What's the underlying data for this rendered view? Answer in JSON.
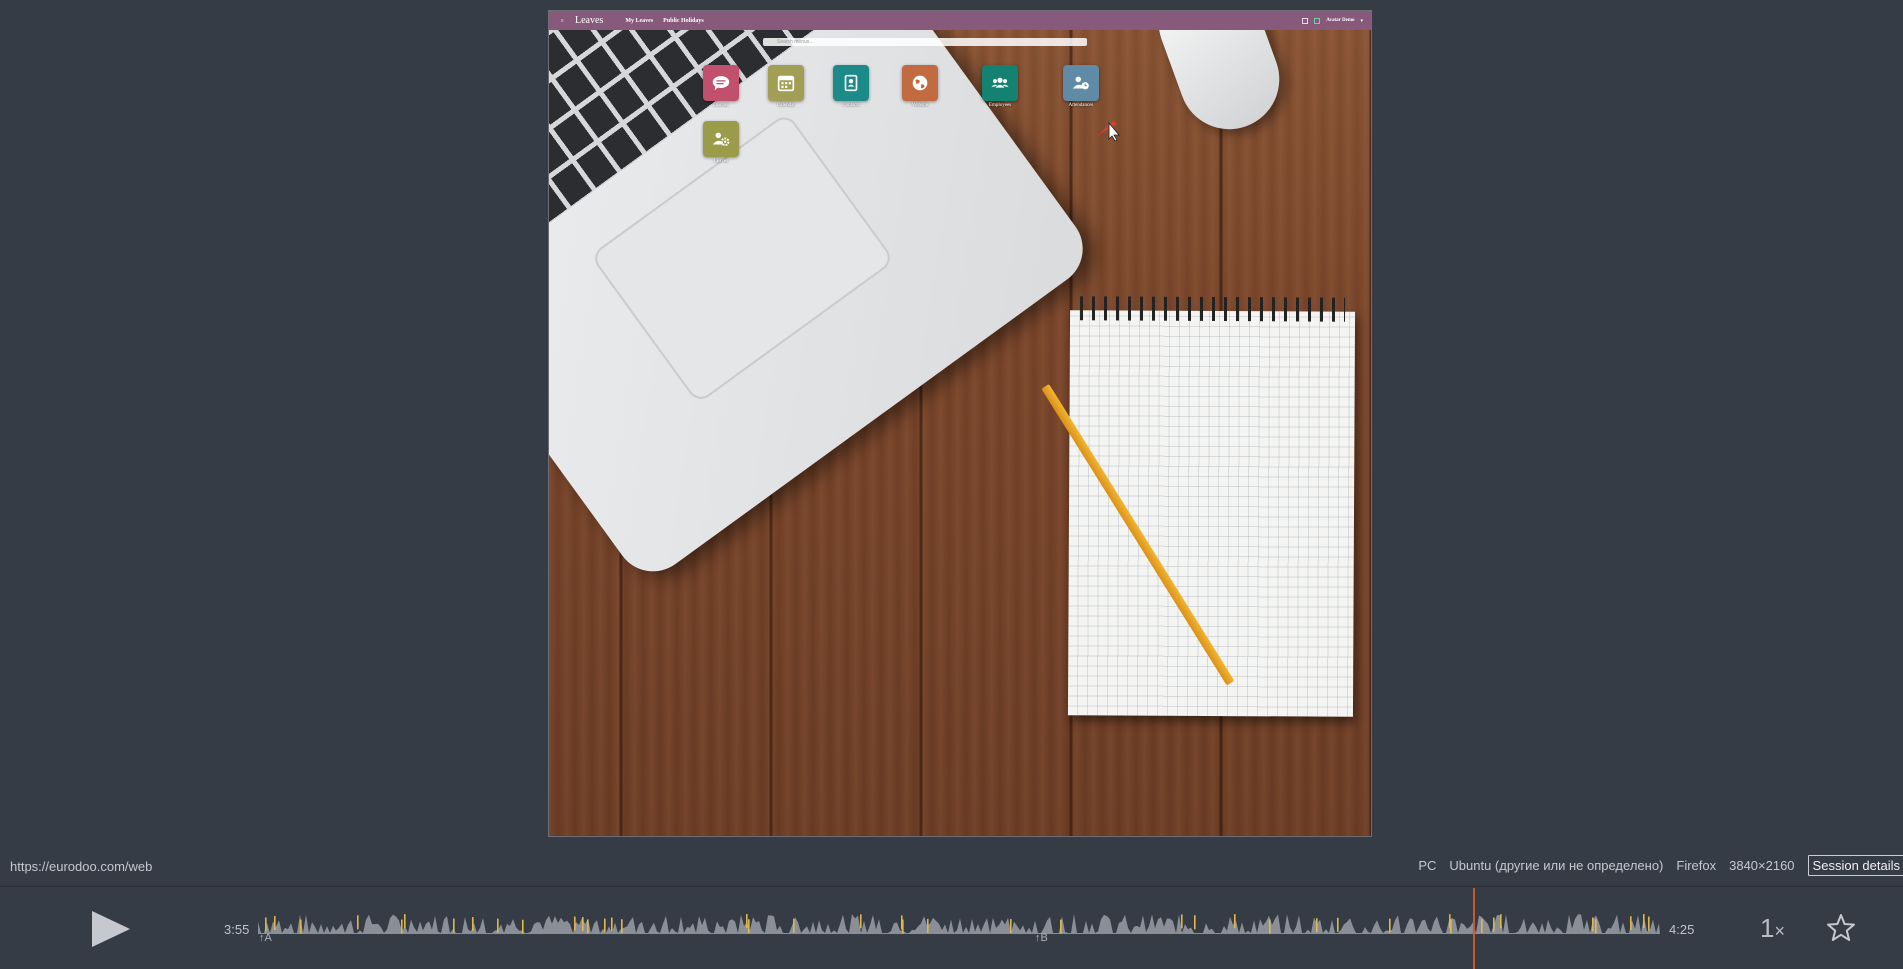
{
  "recorded_page": {
    "brand": "Leaves",
    "menu": [
      "My Leaves",
      "Public Holidays"
    ],
    "user": "Avatar Demo",
    "search_placeholder": "Search menus...",
    "apps": [
      {
        "label": "Discuss",
        "icon": "chat-icon",
        "color": "#c1506d"
      },
      {
        "label": "Calendar",
        "icon": "calendar-icon",
        "color": "#a39e56"
      },
      {
        "label": "Contacts",
        "icon": "contact-card-icon",
        "color": "#1d8a8a"
      },
      {
        "label": "Website",
        "icon": "globe-icon",
        "color": "#c26b41"
      },
      {
        "label": "Employees",
        "icon": "people-icon",
        "color": "#138271"
      },
      {
        "label": "Attendances",
        "icon": "person-clock-icon",
        "color": "#5f8ba6"
      },
      {
        "label": "Leaves",
        "icon": "person-gear-icon",
        "color": "#9a9c49"
      }
    ]
  },
  "info": {
    "url": "https://eurodoo.com/web",
    "device": "PC",
    "os": "Ubuntu (другие или не определено)",
    "browser": "Firefox",
    "resolution": "3840×2160",
    "session_button": "Session details"
  },
  "player": {
    "time_start": "3:55",
    "time_end": "4:25",
    "marker_a": "A",
    "marker_b": "B",
    "speed": "1",
    "speed_suffix": "×",
    "playhead_fraction": 0.84
  },
  "colors": {
    "background": "#363c45",
    "odoo_bar": "#875a7b",
    "playhead": "#c8592b",
    "activity": "#8a8f97",
    "highlight": "#e0b84a"
  }
}
